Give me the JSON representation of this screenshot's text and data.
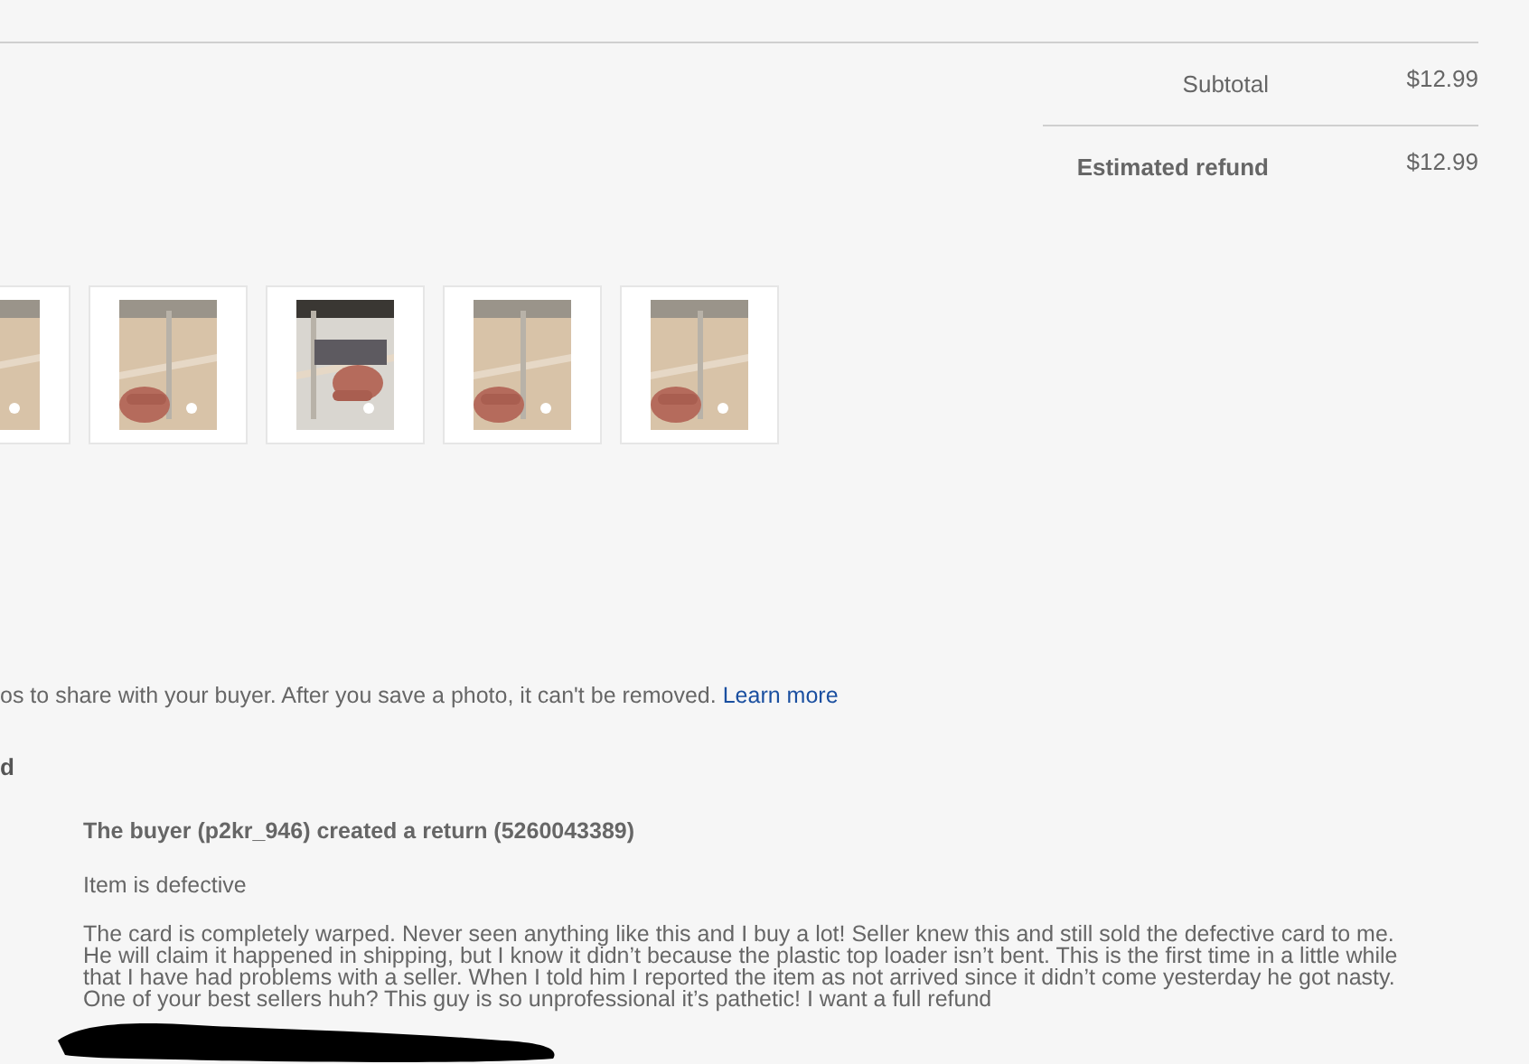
{
  "summary": [
    {
      "label": "Subtotal",
      "value": "$12.99",
      "emphasis": false
    },
    {
      "label": "Estimated refund",
      "value": "$12.99",
      "emphasis": true
    }
  ],
  "photo_notice": {
    "text": "os to share with your buyer. After you save a photo, it can't be removed.",
    "link": "Learn more"
  },
  "section_heading": "d",
  "activity": {
    "heading": "The buyer (p2kr_946) created a return (5260043389)",
    "reason": "Item is defective",
    "comment": "The card is completely warped. Never seen anything like this and I buy a lot! Seller knew this and still sold the defective card to me. He will claim it happened in shipping, but I know it didn’t because the plastic top loader isn’t bent. This is the first time in a little while that I have had problems with a seller. When I told him I reported the item as not arrived since it didn’t come yesterday he got nasty. One of your best sellers huh? This guy is so unprofessional it’s pathetic! I want a full refund"
  }
}
